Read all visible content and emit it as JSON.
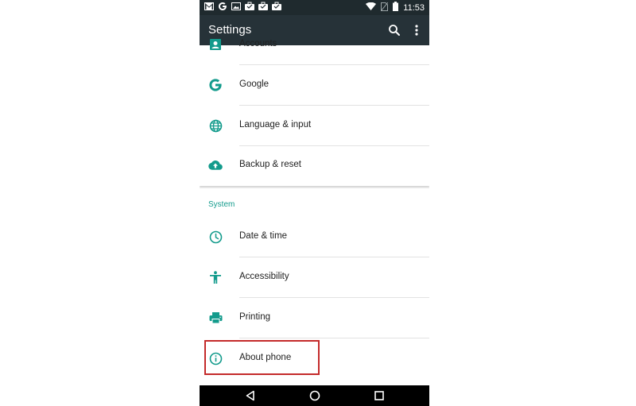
{
  "status_bar": {
    "left_icons": [
      "gmail-icon",
      "google-icon",
      "gallery-icon",
      "briefcase-icon",
      "briefcase-icon",
      "briefcase-icon"
    ],
    "right_icons": [
      "wifi-icon",
      "no-sim-icon",
      "battery-icon"
    ],
    "time": "11:53"
  },
  "toolbar": {
    "title": "Settings",
    "search_icon": "search-icon",
    "more_icon": "more-vert-icon"
  },
  "personal_items": [
    {
      "label": "Accounts",
      "icon": "accounts-icon"
    },
    {
      "label": "Google",
      "icon": "google-g-icon"
    },
    {
      "label": "Language & input",
      "icon": "globe-icon"
    },
    {
      "label": "Backup & reset",
      "icon": "cloud-upload-icon"
    }
  ],
  "system": {
    "header": "System",
    "items": [
      {
        "label": "Date & time",
        "icon": "clock-icon"
      },
      {
        "label": "Accessibility",
        "icon": "accessibility-icon"
      },
      {
        "label": "Printing",
        "icon": "printer-icon"
      },
      {
        "label": "About phone",
        "icon": "info-icon",
        "highlighted": true
      }
    ]
  },
  "nav_bar": {
    "buttons": [
      "back-icon",
      "home-icon",
      "recents-icon"
    ]
  },
  "colors": {
    "accent": "#139b8c",
    "toolbar": "#263238",
    "status_bar": "#1f2a2e",
    "highlight_box": "#c42a2a"
  }
}
